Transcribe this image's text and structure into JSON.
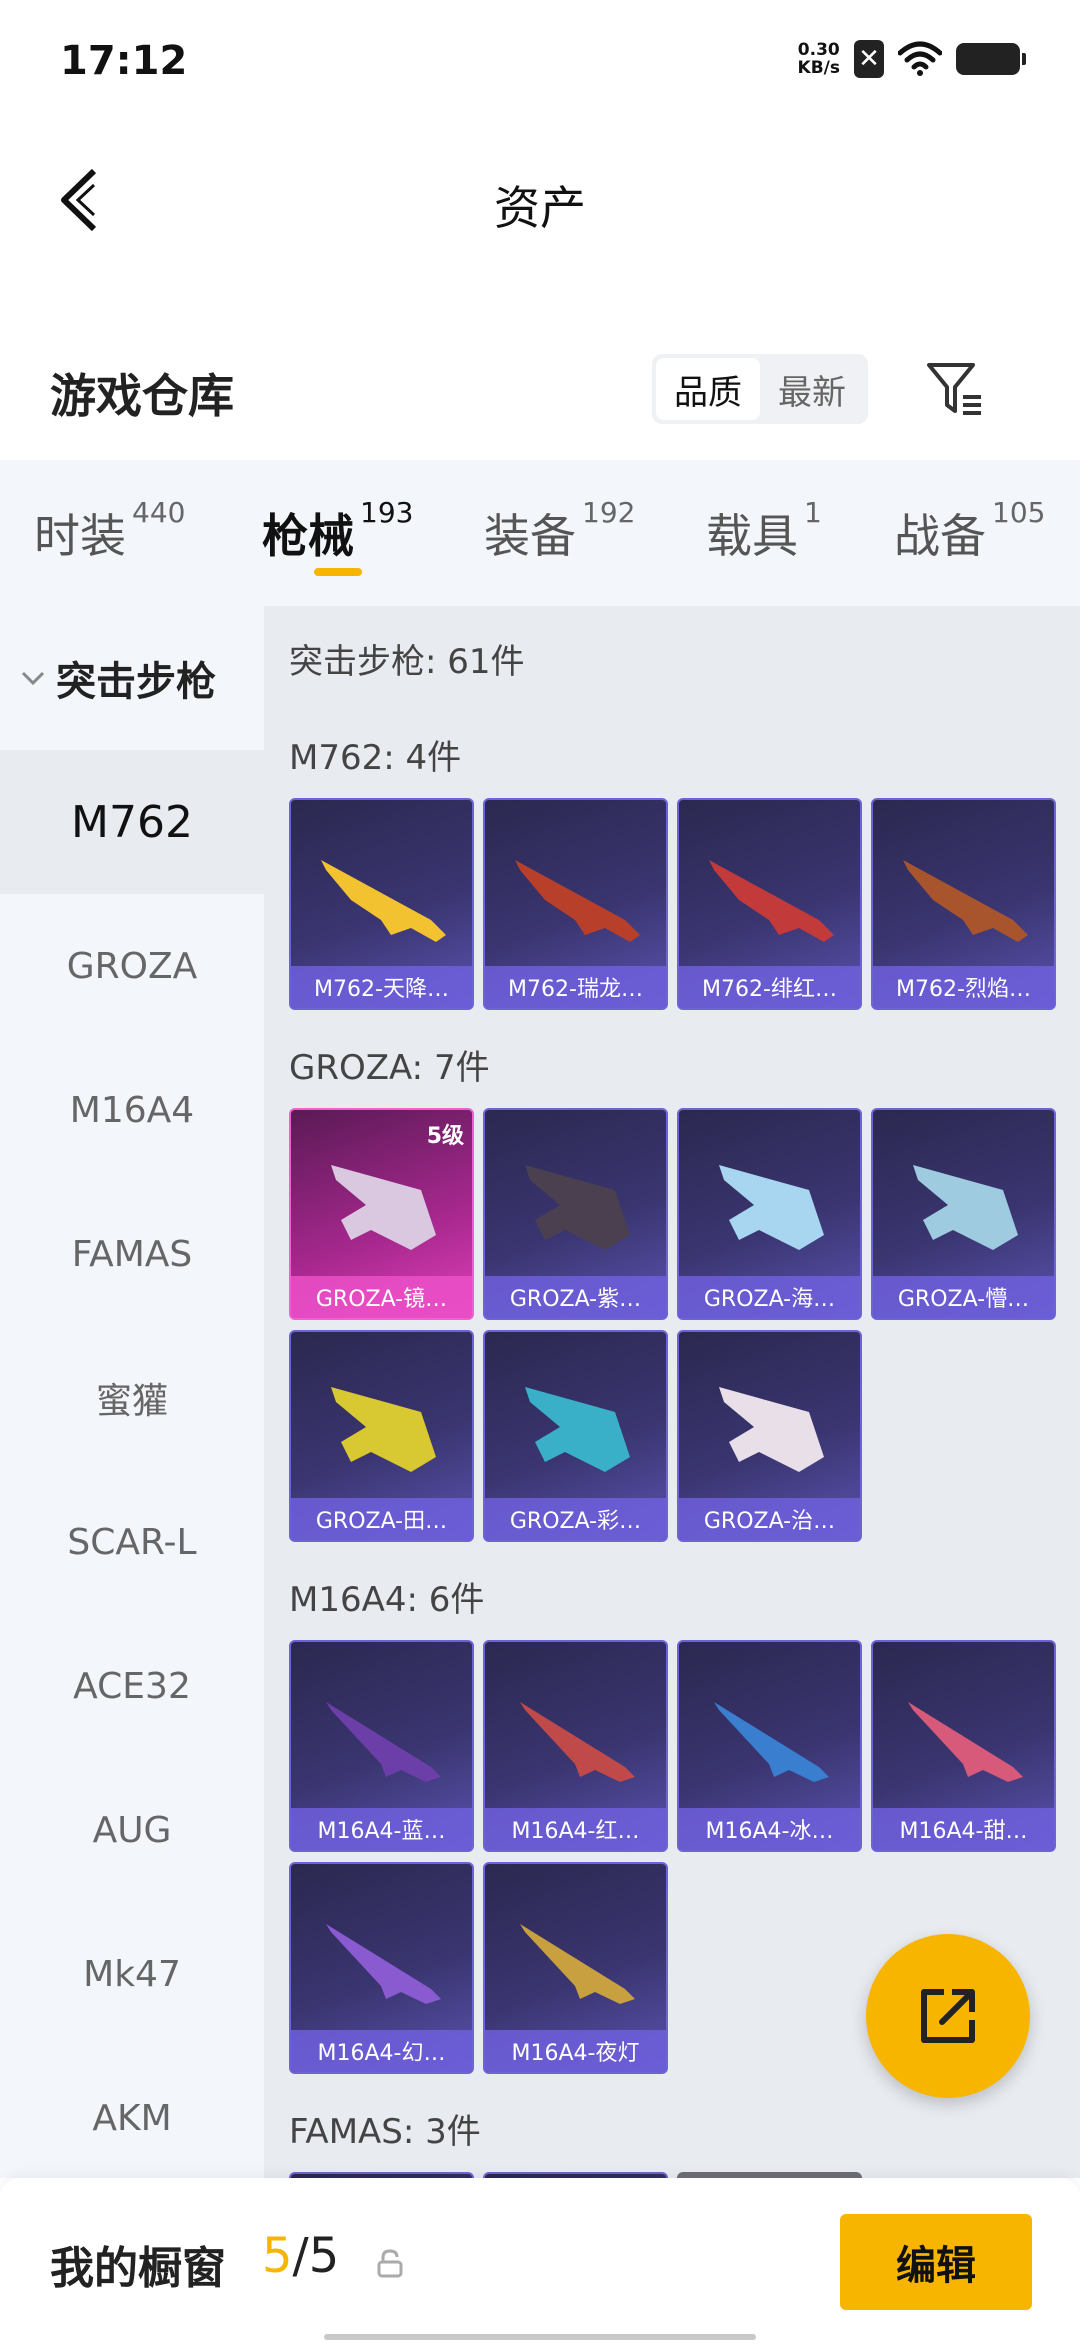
{
  "status": {
    "time": "17:12",
    "net_speed_value": "0.30",
    "net_speed_unit": "KB/s"
  },
  "header": {
    "title": "资产"
  },
  "warehouse": {
    "title": "游戏仓库",
    "sort_options": [
      "品质",
      "最新"
    ],
    "active_sort": "品质"
  },
  "tabs": [
    {
      "label": "时装",
      "count": "440"
    },
    {
      "label": "枪械",
      "count": "193"
    },
    {
      "label": "装备",
      "count": "192"
    },
    {
      "label": "载具",
      "count": "1"
    },
    {
      "label": "战备",
      "count": "105"
    }
  ],
  "active_tab": "枪械",
  "sidebar": {
    "group": "突击步枪",
    "items": [
      "M762",
      "GROZA",
      "M16A4",
      "FAMAS",
      "蜜獾",
      "SCAR-L",
      "ACE32",
      "AUG",
      "Mk47",
      "AKM"
    ],
    "active": "M762"
  },
  "content": {
    "summary": "突击步枪: 61件",
    "categories": [
      {
        "title": "M762: 4件",
        "items": [
          {
            "label": "M762-天降…"
          },
          {
            "label": "M762-瑞龙…"
          },
          {
            "label": "M762-绯红…"
          },
          {
            "label": "M762-烈焰…"
          }
        ]
      },
      {
        "title": "GROZA: 7件",
        "items": [
          {
            "label": "GROZA-镜…",
            "level": "5级",
            "rarity": "gold"
          },
          {
            "label": "GROZA-紫…"
          },
          {
            "label": "GROZA-海…"
          },
          {
            "label": "GROZA-懵…"
          },
          {
            "label": "GROZA-田…"
          },
          {
            "label": "GROZA-彩…"
          },
          {
            "label": "GROZA-治…"
          }
        ]
      },
      {
        "title": "M16A4: 6件",
        "items": [
          {
            "label": "M16A4-蓝…"
          },
          {
            "label": "M16A4-红…"
          },
          {
            "label": "M16A4-冰…"
          },
          {
            "label": "M16A4-甜…"
          },
          {
            "label": "M16A4-幻…"
          },
          {
            "label": "M16A4-夜灯"
          }
        ]
      },
      {
        "title": "FAMAS: 3件",
        "items": []
      }
    ]
  },
  "bottom": {
    "showcase_label": "我的橱窗",
    "showcase_current": "5",
    "showcase_separator": "/",
    "showcase_total": "5",
    "edit_label": "编辑"
  },
  "colors": {
    "accent": "#f7b500",
    "card_purple": "#3a3570",
    "card_gold": "#a8288f"
  },
  "icons": {
    "back": "back-arrow-icon",
    "filter": "filter-icon",
    "share": "share-external-icon",
    "lock": "lock-icon"
  }
}
